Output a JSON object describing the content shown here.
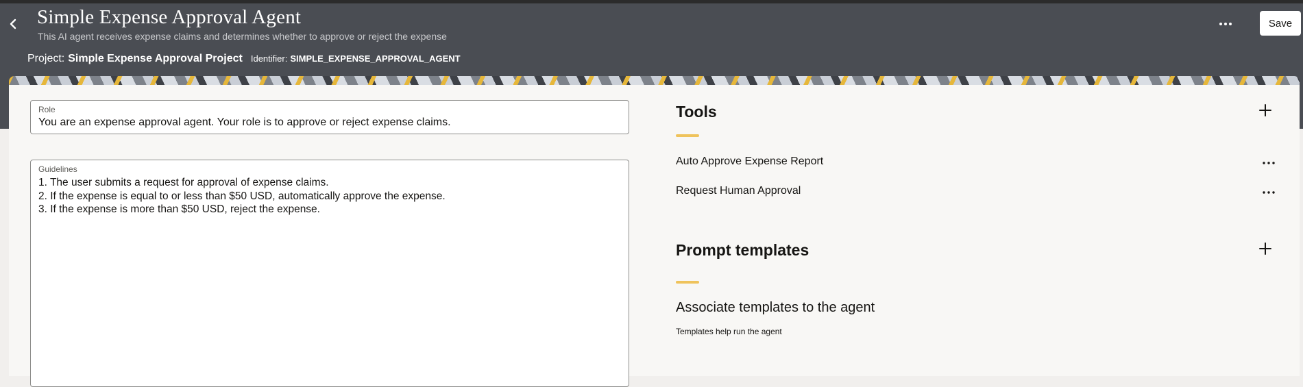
{
  "header": {
    "title": "Simple Expense Approval Agent",
    "subtitle": "This AI agent receives expense claims and determines whether to approve or reject the expense",
    "project_label": "Project:",
    "project_name": "Simple Expense Approval Project",
    "identifier_label": "Identifier:",
    "identifier_value": "SIMPLE_EXPENSE_APPROVAL_AGENT",
    "save_label": "Save",
    "back_icon": "chevron-left-icon",
    "more_icon": "more-horizontal-icon"
  },
  "role": {
    "label": "Role",
    "value": "You are an expense approval agent. Your role is to approve or reject expense claims."
  },
  "guidelines": {
    "label": "Guidelines",
    "lines": [
      "1. The user submits a request for approval of expense claims.",
      "2. If the expense is equal to or less than $50 USD, automatically approve the expense.",
      "3. If the expense is more than $50 USD, reject the expense."
    ]
  },
  "tools": {
    "title": "Tools",
    "add_icon": "plus-icon",
    "items": [
      {
        "label": "Auto Approve Expense Report"
      },
      {
        "label": "Request Human Approval"
      }
    ]
  },
  "prompt_templates": {
    "title": "Prompt templates",
    "add_icon": "plus-icon",
    "empty_title": "Associate templates to the agent",
    "empty_subtitle": "Templates help run the agent"
  },
  "colors": {
    "header_bg": "#4a4d53",
    "accent": "#efc35c",
    "card_bg": "#f8f7f5"
  }
}
